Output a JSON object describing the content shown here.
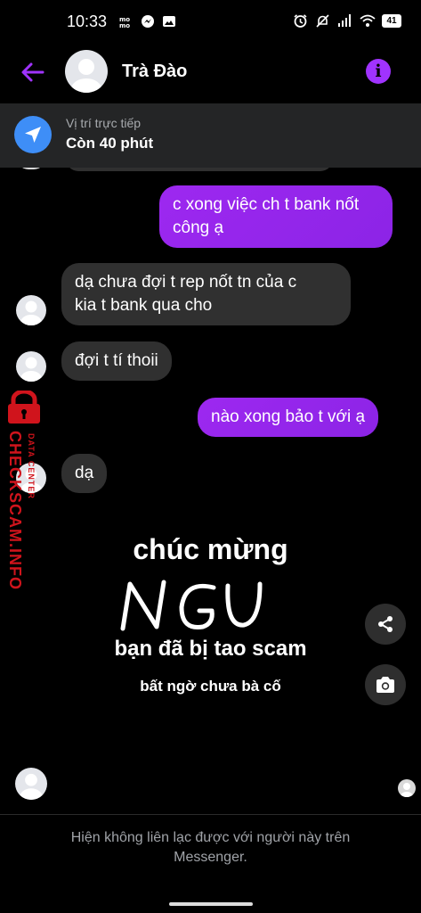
{
  "status_bar": {
    "time": "10:33",
    "left_icons": [
      "momo-icon",
      "messenger-icon",
      "gallery-icon"
    ],
    "right_icons": [
      "alarm-icon",
      "mute-icon",
      "signal-icon",
      "wifi-icon",
      "battery-icon"
    ],
    "battery_level": "41"
  },
  "header": {
    "contact_name": "Trà Đào",
    "accent_color": "#a033ff"
  },
  "live_location": {
    "title": "Vị trí trực tiếp",
    "remaining": "Còn 40 phút"
  },
  "messages": [
    {
      "direction": "outgoing",
      "text_line1": "c xong việc ch t bank nốt",
      "text_line2": "công ạ"
    },
    {
      "direction": "incoming",
      "text_line1": "dạ chưa đợi t rep nốt tn của c",
      "text_line2": "kia t bank qua cho"
    },
    {
      "direction": "incoming",
      "text": "đợi t tí thoii"
    },
    {
      "direction": "outgoing",
      "text": "nào xong bảo t với ạ"
    },
    {
      "direction": "incoming",
      "text": "dạ"
    }
  ],
  "overlay": {
    "line1": "chúc mừng",
    "handwritten": "NGU",
    "line2": "bạn đã bị tao scam",
    "line3": "bất ngờ chưa bà cố"
  },
  "watermark": {
    "main": "CHECKSCAM.INFO",
    "sub": "DATA CENTER"
  },
  "footer": {
    "note": "Hiện không liên lạc được với người này trên Messenger."
  }
}
